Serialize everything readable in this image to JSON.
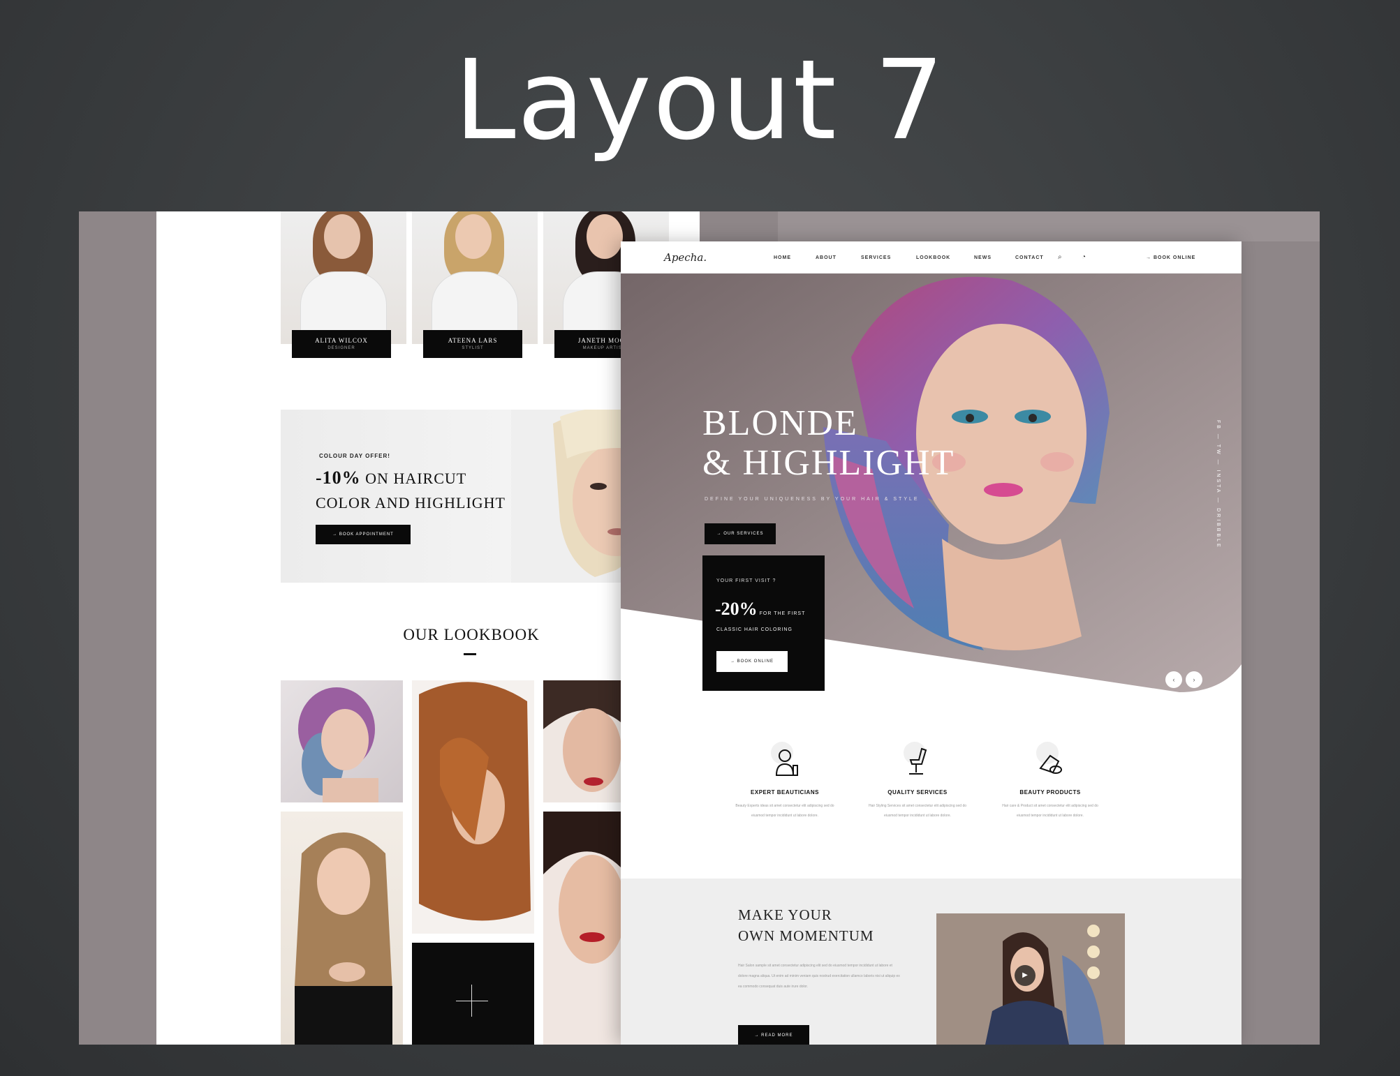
{
  "slide": {
    "title": "Layout 7"
  },
  "left_page": {
    "team": [
      {
        "name": "ALITA WILCOX",
        "role": "DESIGNER"
      },
      {
        "name": "ATEENA LARS",
        "role": "STYLIST"
      },
      {
        "name": "JANETH MOOR",
        "role": "MAKEUP ARTIST"
      }
    ],
    "offer": {
      "kicker": "COLOUR DAY OFFER!",
      "discount": "-10%",
      "line1_rest": " ON HAIRCUT",
      "line2": "COLOR AND HIGHLIGHT",
      "button": "→  BOOK APPOINTMENT"
    },
    "lookbook": {
      "title": "OUR LOOKBOOK"
    }
  },
  "right_page": {
    "nav": {
      "logo": "Apecha.",
      "items": [
        "HOME",
        "ABOUT",
        "SERVICES",
        "LOOKBOOK",
        "NEWS",
        "CONTACT"
      ],
      "search_icon": "⌕",
      "cart_icon": "◔",
      "book_online": "→  BOOK ONLINE"
    },
    "hero": {
      "title_line1": "BLONDE",
      "title_line2": "& HIGHLIGHT",
      "subtitle": "DEFINE YOUR UNIQUENESS BY YOUR HAIR & STYLE",
      "button": "→  OUR SERVICES",
      "vertical_text": "FB — TW — INSTA — DRIBBBLE",
      "prev": "‹",
      "next": "›"
    },
    "visit": {
      "kicker": "YOUR FIRST VISIT ?",
      "discount": "-20%",
      "line1_rest": " FOR THE FIRST",
      "line2": "CLASSIC HAIR COLORING",
      "button": "→  BOOK ONLINE"
    },
    "features": [
      {
        "icon": "beautician-icon",
        "title": "EXPERT BEAUTICIANS",
        "desc": "Beauty Experts ideas sit amet consectetur elit adipiscing sed do eiusmod tempor incididunt ut labore dolore."
      },
      {
        "icon": "salon-chair-icon",
        "title": "QUALITY SERVICES",
        "desc": "Hair Styling Services sit amet consectetur elit adipiscing sed do eiusmod tempor incididunt ut labore dolore."
      },
      {
        "icon": "beauty-products-icon",
        "title": "BEAUTY PRODUCTS",
        "desc": "Hair care & Product sit amet consectetur elit adipiscing sed do eiusmod tempor incididunt ut labore dolore."
      }
    ],
    "momentum": {
      "title_line1": "MAKE YOUR",
      "title_line2": "OWN MOMENTUM",
      "text": "Hair Salon sample sit amet consectetur adipiscing elit sed do eiusmod tempor incididunt ut labore et dolore magna aliqua. Ut enim ad minim veniam quis nostrud exercitation ullamco laboris nisi ut aliquip ex ea commodo consequat duis aute irure dolor.",
      "button": "→  READ MORE",
      "play_icon": "▶"
    }
  }
}
